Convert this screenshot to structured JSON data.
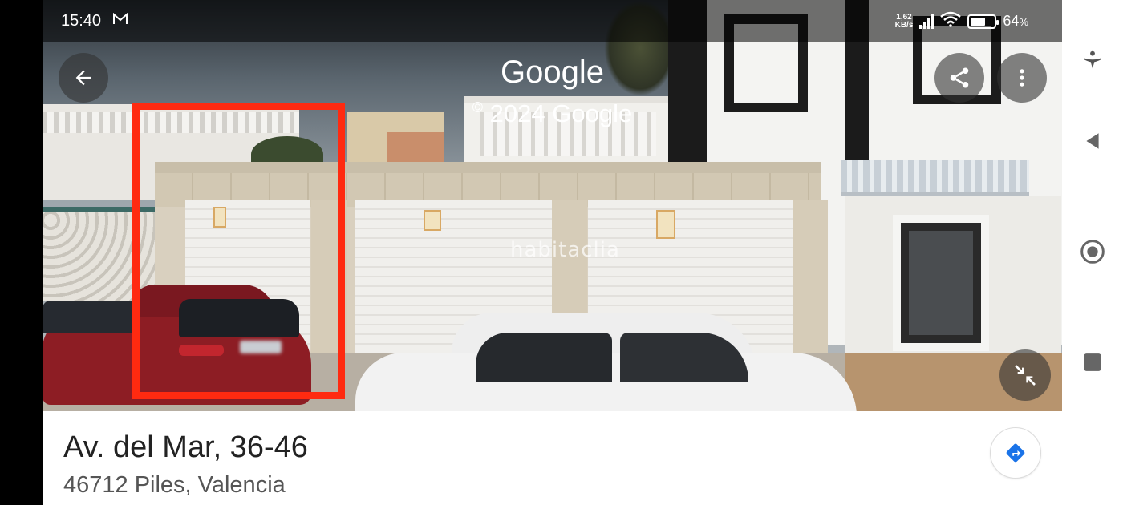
{
  "status_bar": {
    "time": "15:40",
    "mail_icon": "gmail-icon",
    "net_speed_value": "1,62",
    "net_speed_unit": "KB/s",
    "battery_percent": "64",
    "battery_suffix": "%",
    "battery_level": 0.64
  },
  "street_view": {
    "brand": "Google",
    "copyright": "2024 Google",
    "copyright_symbol": "©",
    "watermark": "habitaclia",
    "highlight_color": "#ff2a10",
    "buttons": {
      "back": "arrow-back-icon",
      "share": "share-icon",
      "more": "more-vertical-icon",
      "collapse": "collapse-icon"
    }
  },
  "place": {
    "title": "Av. del Mar, 36-46",
    "subtitle": "46712 Piles, Valencia",
    "directions_icon": "directions-icon",
    "directions_color": "#1a73e8"
  },
  "android_nav": {
    "items": [
      "accessibility-icon",
      "back-icon",
      "home-icon",
      "recents-icon"
    ]
  }
}
